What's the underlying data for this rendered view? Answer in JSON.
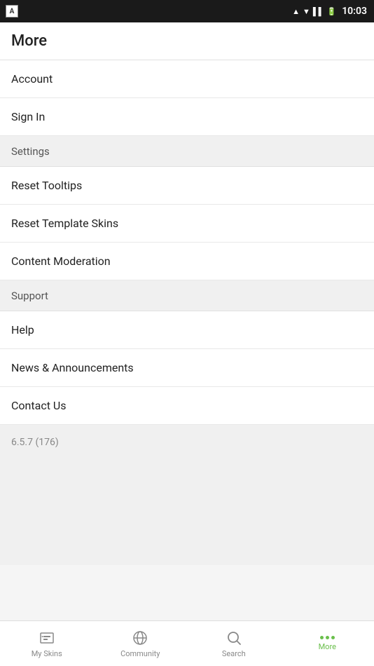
{
  "status_bar": {
    "time": "10:03",
    "app_label": "A"
  },
  "header": {
    "title": "More"
  },
  "menu": {
    "sections": [
      {
        "type": "item",
        "label": "Account",
        "id": "account"
      },
      {
        "type": "item",
        "label": "Sign In",
        "id": "sign-in"
      },
      {
        "type": "section-header",
        "label": "Settings",
        "id": "settings"
      },
      {
        "type": "item",
        "label": "Reset Tooltips",
        "id": "reset-tooltips"
      },
      {
        "type": "item",
        "label": "Reset Template Skins",
        "id": "reset-template-skins"
      },
      {
        "type": "item",
        "label": "Content Moderation",
        "id": "content-moderation"
      },
      {
        "type": "section-header",
        "label": "Support",
        "id": "support"
      },
      {
        "type": "item",
        "label": "Help",
        "id": "help"
      },
      {
        "type": "item",
        "label": "News & Announcements",
        "id": "news-announcements"
      },
      {
        "type": "item",
        "label": "Contact Us",
        "id": "contact-us"
      }
    ],
    "version": "6.5.7 (176)"
  },
  "bottom_nav": {
    "items": [
      {
        "id": "my-skins",
        "label": "My Skins",
        "active": false
      },
      {
        "id": "community",
        "label": "Community",
        "active": false
      },
      {
        "id": "search",
        "label": "Search",
        "active": false
      },
      {
        "id": "more",
        "label": "More",
        "active": true
      }
    ]
  }
}
